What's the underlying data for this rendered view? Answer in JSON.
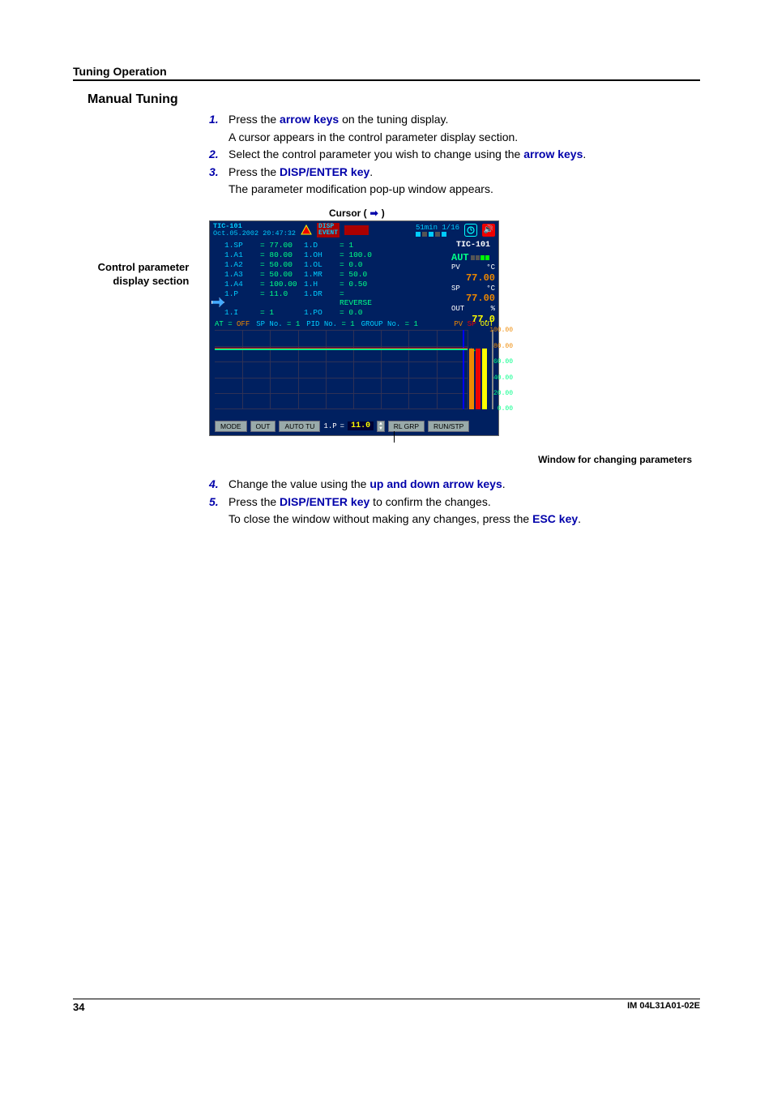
{
  "header": "Tuning Operation",
  "title": "Manual Tuning",
  "steps": [
    {
      "num": "1.",
      "pre": "Press the ",
      "key": "arrow keys",
      "post": " on the tuning display.",
      "followup": "A cursor appears in the control parameter display section."
    },
    {
      "num": "2.",
      "pre": "Select the control parameter you wish to change using the ",
      "key": "arrow keys",
      "post": "."
    },
    {
      "num": "3.",
      "pre": "Press the ",
      "key": "DISP/ENTER key",
      "post": ".",
      "followup": "The parameter modification pop-up window appears."
    }
  ],
  "cursor_label": "Cursor (",
  "cursor_label_close": ")",
  "side_label": {
    "l1": "Control parameter",
    "l2": "display section"
  },
  "screen": {
    "tag": "TIC-101",
    "timestamp": "Oct.05.2002 20:47:32",
    "disp_event": {
      "l1": "DISP",
      "l2": "EVENT"
    },
    "time_div": "51min  1/16",
    "params": [
      {
        "a": "1.SP",
        "av": "= 77.00",
        "b": "1.D",
        "bv": "= 1"
      },
      {
        "a": "1.A1",
        "av": "= 80.00",
        "b": "1.OH",
        "bv": "= 100.0"
      },
      {
        "a": "1.A2",
        "av": "= 50.00",
        "b": "1.OL",
        "bv": "= 0.0"
      },
      {
        "a": "1.A3",
        "av": "= 50.00",
        "b": "1.MR",
        "bv": "= 50.0"
      },
      {
        "a": "1.A4",
        "av": "= 100.00",
        "b": "1.H",
        "bv": "= 0.50"
      },
      {
        "a": "1.P",
        "av": "= 11.0",
        "b": "1.DR",
        "bv": "= REVERSE"
      },
      {
        "a": "1.I",
        "av": "= 1",
        "b": "1.PO",
        "bv": "= 0.0"
      }
    ],
    "status": {
      "at": "AT =",
      "at_val": "OFF",
      "sp_no": "SP No.",
      "sp_no_val": "= 1",
      "pid_no": "PID No.",
      "pid_no_val": "= 1",
      "group_no": "GROUP No.",
      "group_no_val": "= 1",
      "pv": "PV",
      "sp": "SP",
      "out": "OUT"
    },
    "right": {
      "tag": "TIC-101",
      "aut": "AUT",
      "pv_lbl": "PV",
      "pv_unit": "°C",
      "pv_val": "77.00",
      "sp_lbl": "SP",
      "sp_unit": "°C",
      "sp_val": "77.00",
      "out_lbl": "OUT",
      "out_unit": "%",
      "out_val": "77.0"
    },
    "y_axis": [
      "100.00",
      "80.00",
      "60.00",
      "40.00",
      "20.00",
      "0.00"
    ],
    "footer": {
      "mode": "MODE",
      "out": "OUT",
      "auto_tu": "AUTO TU",
      "edit_label": "1.P",
      "equals": "=",
      "value": "11.0",
      "rl_grp": "RL GRP",
      "run_stp": "RUN/STP"
    }
  },
  "fig_caption": "Window for changing parameters",
  "steps_after": [
    {
      "num": "4.",
      "pre": "Change the value using the ",
      "key": "up and down arrow keys",
      "post": "."
    },
    {
      "num": "5.",
      "pre": "Press the ",
      "key": "DISP/ENTER key",
      "post": " to confirm the changes.",
      "followup_pre": "To close the window without making any changes, press the ",
      "followup_key": "ESC key",
      "followup_post": "."
    }
  ],
  "page_num": "34",
  "doc_id": "IM 04L31A01-02E"
}
